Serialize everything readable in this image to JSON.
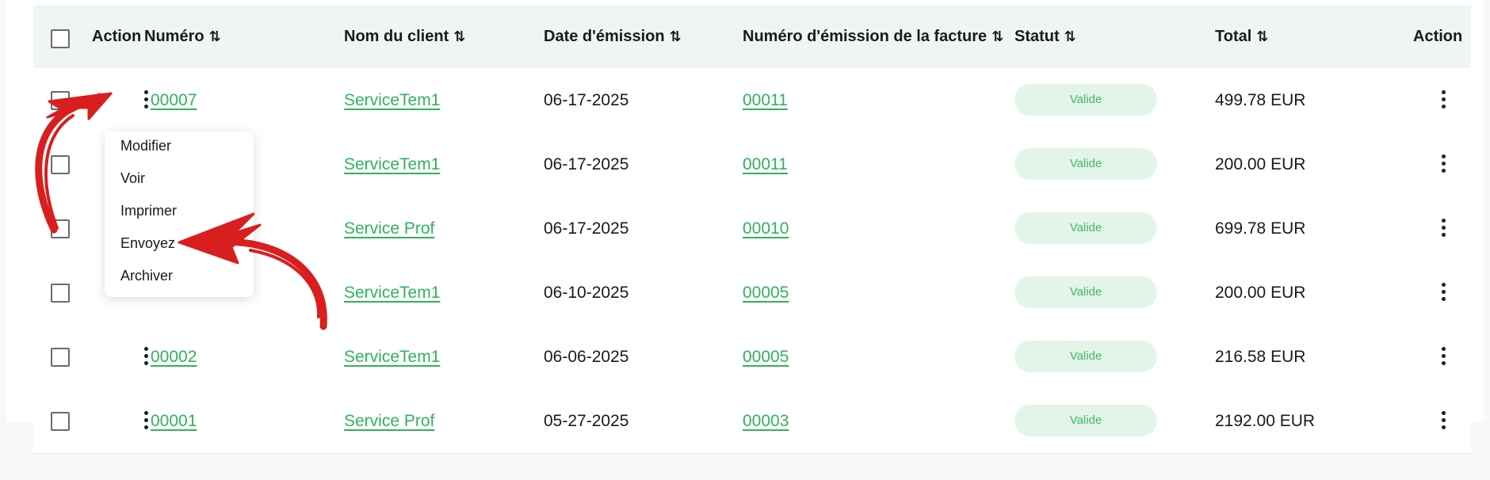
{
  "table": {
    "columns": [
      {
        "label": "Action",
        "sortable": false
      },
      {
        "label": "Numéro",
        "sortable": true
      },
      {
        "label": "Nom du client",
        "sortable": true
      },
      {
        "label": "Date d'émission",
        "sortable": true
      },
      {
        "label": "Numéro d'émission de la facture",
        "sortable": true
      },
      {
        "label": "Statut",
        "sortable": true
      },
      {
        "label": "Total",
        "sortable": true
      },
      {
        "label": "Action",
        "sortable": false
      }
    ],
    "sort_icon": "sort-arrows-icon",
    "sort_glyph": "⇅",
    "rows": [
      {
        "numero": "00007",
        "client": "ServiceTem1",
        "date": "06-17-2025",
        "facture": "00011",
        "statut": "Valide",
        "total": "499.78 EUR"
      },
      {
        "numero": "",
        "client": "ServiceTem1",
        "date": "06-17-2025",
        "facture": "00011",
        "statut": "Valide",
        "total": "200.00 EUR"
      },
      {
        "numero": "",
        "client": "Service Prof",
        "date": "06-17-2025",
        "facture": "00010",
        "statut": "Valide",
        "total": "699.78 EUR"
      },
      {
        "numero": "",
        "client": "ServiceTem1",
        "date": "06-10-2025",
        "facture": "00005",
        "statut": "Valide",
        "total": "200.00 EUR"
      },
      {
        "numero": "00002",
        "client": "ServiceTem1",
        "date": "06-06-2025",
        "facture": "00005",
        "statut": "Valide",
        "total": "216.58 EUR"
      },
      {
        "numero": "00001",
        "client": "Service Prof",
        "date": "05-27-2025",
        "facture": "00003",
        "statut": "Valide",
        "total": "2192.00 EUR"
      }
    ]
  },
  "context_menu": {
    "items": [
      "Modifier",
      "Voir",
      "Imprimer",
      "Envoyez",
      "Archiver"
    ]
  },
  "colors": {
    "accent_green": "#2fb35a",
    "header_bg": "#eff6f1",
    "badge_bg": "#e3f5e8",
    "annotation_red": "#d81e1e"
  }
}
